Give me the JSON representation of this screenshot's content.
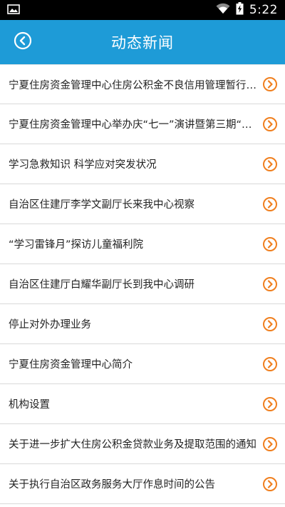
{
  "status_bar": {
    "time": "5:22",
    "icons": [
      "image-notification-icon",
      "wifi-icon",
      "battery-charging-icon"
    ]
  },
  "header": {
    "title": "动态新闻",
    "back_icon": "back-circle-icon",
    "bg_color": "#1e9bd7"
  },
  "news": {
    "accent_color": "#f07f1e",
    "item_icon": "chevron-right-circle-icon",
    "items": [
      {
        "title": "宁夏住房资金管理中心住房公积金不良信用管理暂行办法"
      },
      {
        "title": "宁夏住房资金管理中心举办庆“七一”演讲暨第三期“读书讲坛”活动"
      },
      {
        "title": "学习急救知识 科学应对突发状况"
      },
      {
        "title": "自治区住建厅李学文副厅长来我中心视察"
      },
      {
        "title": "“学习雷锋月”探访儿童福利院"
      },
      {
        "title": "自治区住建厅白耀华副厅长到我中心调研"
      },
      {
        "title": "停止对外办理业务"
      },
      {
        "title": "宁夏住房资金管理中心简介"
      },
      {
        "title": "机构设置"
      },
      {
        "title": "关于进一步扩大住房公积金贷款业务及提取范围的通知"
      },
      {
        "title": "关于执行自治区政务服务大厅作息时间的公告"
      }
    ]
  }
}
